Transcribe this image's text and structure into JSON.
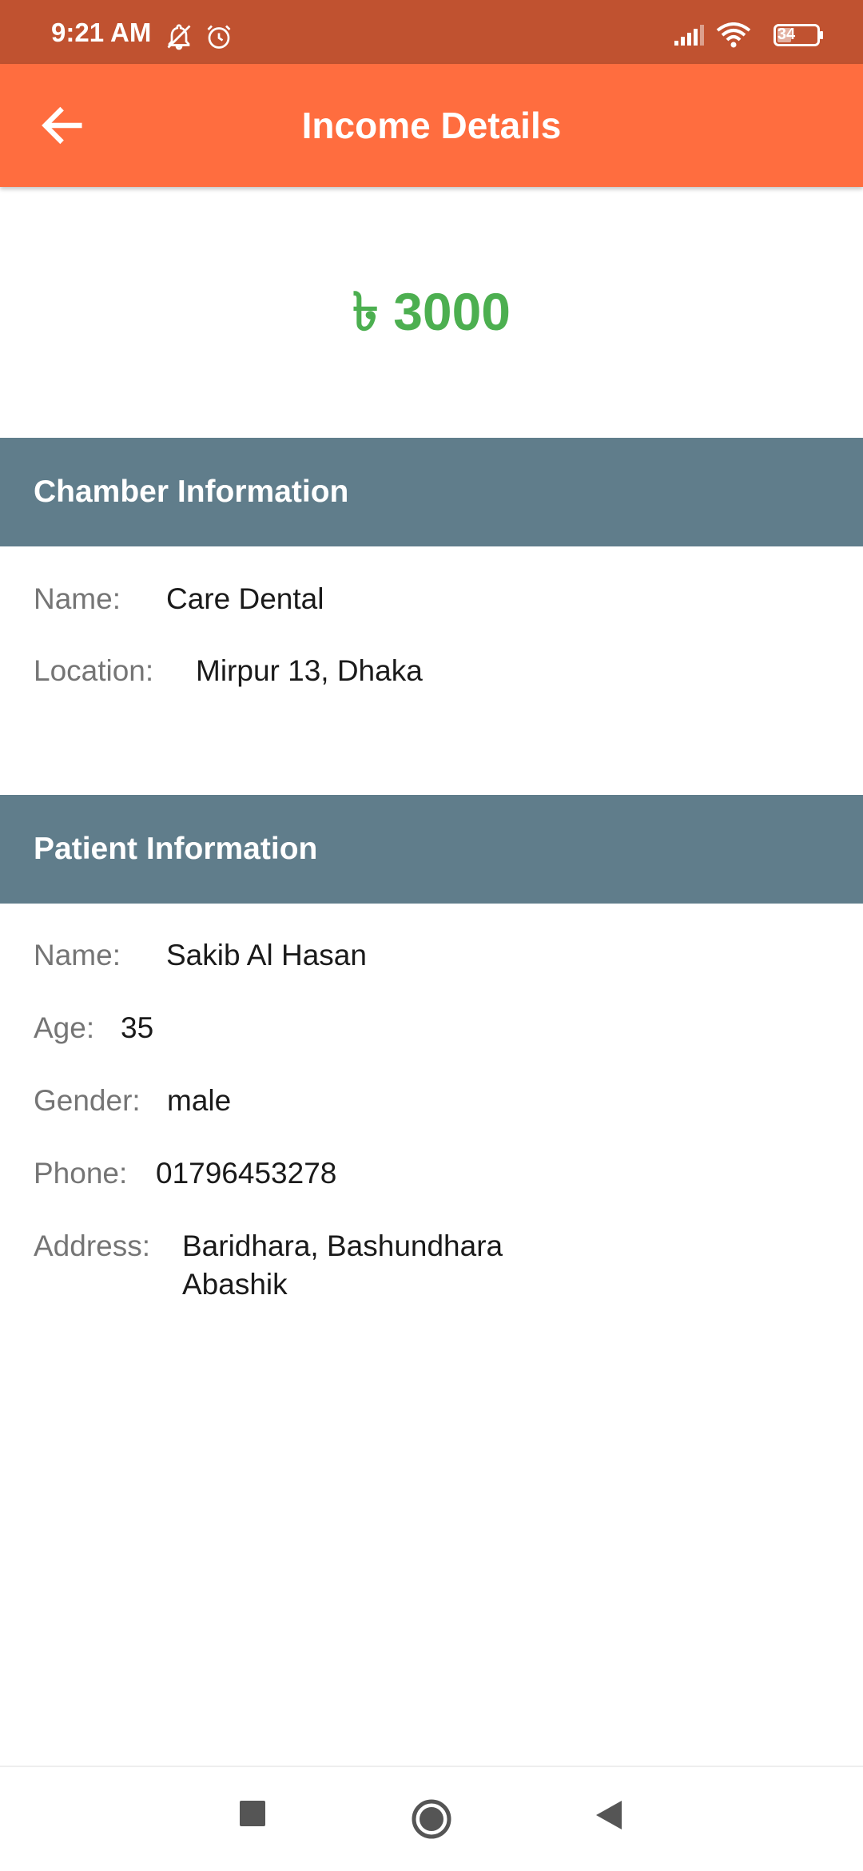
{
  "status_bar": {
    "time": "9:21 AM",
    "battery_level": "34",
    "icons": [
      "muted-bell-icon",
      "alarm-icon",
      "signal-icon",
      "wifi-icon",
      "battery-icon"
    ]
  },
  "app_bar": {
    "title": "Income Details",
    "back_icon": "arrow-left-icon"
  },
  "amount": {
    "currency": "৳",
    "value": "3000",
    "color": "#4caf50"
  },
  "chamber": {
    "header": "Chamber Information",
    "name_label": "Name:",
    "name": "Care Dental",
    "location_label": "Location:",
    "location": "Mirpur 13, Dhaka"
  },
  "patient": {
    "header": "Patient Information",
    "name_label": "Name:",
    "name": "Sakib Al Hasan",
    "age_label": "Age:",
    "age": "35",
    "gender_label": "Gender:",
    "gender": "male",
    "phone_label": "Phone:",
    "phone": "01796453278",
    "address_label": "Address:",
    "address_line1": "Baridhara, Bashundhara",
    "address_line2": "Abashik"
  },
  "colors": {
    "status_bar": "#c05230",
    "app_bar": "#ff6d3f",
    "section_header": "#607d8b"
  },
  "nav_bar": {
    "icons": [
      "recents-square-icon",
      "home-circle-icon",
      "back-triangle-icon"
    ]
  }
}
